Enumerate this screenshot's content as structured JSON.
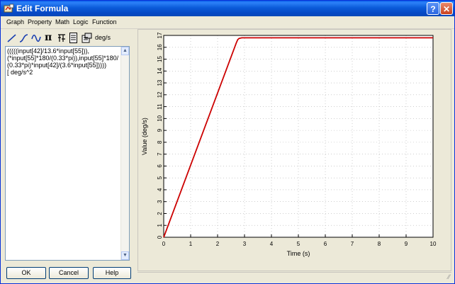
{
  "window": {
    "title": "Edit Formula",
    "help_btn": "?",
    "close_btn": "✕"
  },
  "menu": [
    "Graph",
    "Property",
    "Math",
    "Logic",
    "Function"
  ],
  "toolbar": {
    "icons": [
      "line-icon",
      "curve-icon",
      "sine-icon",
      "pi-icon",
      "sensor-icon",
      "table-icon",
      "variable-icon"
    ],
    "pi": "π",
    "unit": "deg/s"
  },
  "formula": {
    "text": "(((((input[42]/13.6*input[55])),(*input[55]*180/(0.33*pi)),input[55]*180/(0.33*pi)*input[42]/(3.6*input[55]))))\n[ deg/s^2"
  },
  "buttons": {
    "ok": "OK",
    "cancel": "Cancel",
    "help": "Help"
  },
  "chart_data": {
    "type": "line",
    "title": "",
    "xlabel": "Time (s)",
    "ylabel": "Value (deg/s)",
    "xlim": [
      0,
      10
    ],
    "ylim": [
      0,
      17
    ],
    "xticks": [
      0,
      1,
      2,
      3,
      4,
      5,
      6,
      7,
      8,
      9,
      10
    ],
    "yticks": [
      0,
      1,
      2,
      3,
      4,
      5,
      6,
      7,
      8,
      9,
      10,
      11,
      12,
      13,
      14,
      15,
      16,
      17
    ],
    "grid": true,
    "series": [
      {
        "color": "#cc0000",
        "x": [
          0,
          2.7,
          2.75,
          2.8,
          2.9,
          10
        ],
        "y": [
          0,
          16.4,
          16.65,
          16.75,
          16.8,
          16.8
        ]
      }
    ]
  }
}
